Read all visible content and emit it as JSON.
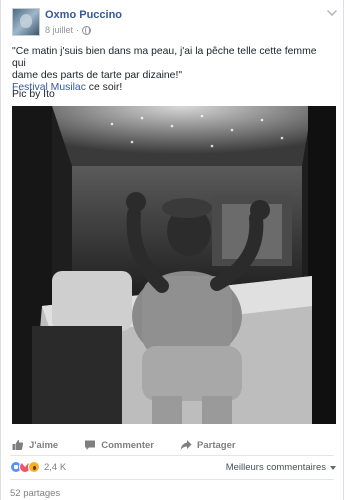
{
  "post": {
    "author": "Oxmo Puccino",
    "date": "8 juillet",
    "separator": "·",
    "text_line1": "\"Ce matin j'suis bien dans ma peau, j'ai la pêche telle cette femme qui",
    "text_line2": "dame des parts de tarte par dizaine!\"",
    "link_text": "Festival Musilac",
    "text_after_link": " ce soir!",
    "credit": "Pic by Ito"
  },
  "actions": {
    "like": "J'aime",
    "comment": "Commenter",
    "share": "Partager"
  },
  "reactions": {
    "count": "2,4 K",
    "sort_label": "Meilleurs commentaires",
    "types": [
      "like-icon",
      "love-icon",
      "wow-icon"
    ]
  },
  "shares": "52 partages",
  "colors": {
    "link": "#365899",
    "muted": "#90949c"
  }
}
